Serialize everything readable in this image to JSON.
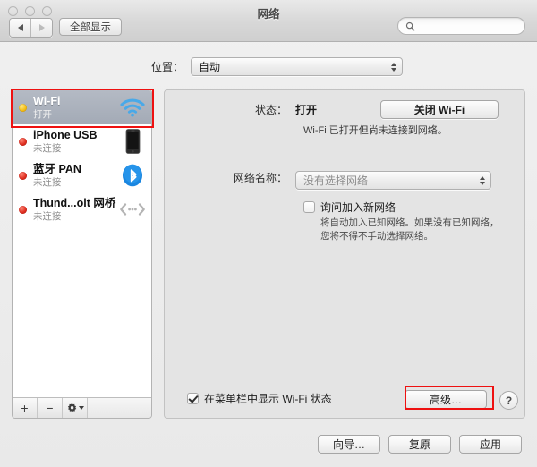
{
  "window": {
    "title": "网络",
    "traffic_lights": [
      "close",
      "minimize",
      "zoom"
    ]
  },
  "toolbar": {
    "back_icon": "triangle-left-icon",
    "forward_icon": "triangle-right-icon",
    "show_all_label": "全部显示",
    "search_placeholder": "",
    "search_value": "",
    "search_icon": "search-icon"
  },
  "location": {
    "label": "位置：",
    "selected": "自动"
  },
  "sidebar": {
    "services": [
      {
        "name": "Wi-Fi",
        "state": "打开",
        "status": "on",
        "dot_color": "#f5c018",
        "icon": "wifi-icon",
        "selected": true
      },
      {
        "name": "iPhone USB",
        "state": "未连接",
        "status": "off",
        "dot_color": "#e03022",
        "icon": "iphone-icon",
        "selected": false
      },
      {
        "name": "蓝牙 PAN",
        "state": "未连接",
        "status": "off",
        "dot_color": "#e03022",
        "icon": "bluetooth-icon",
        "selected": false
      },
      {
        "name": "Thund...olt 网桥",
        "state": "未连接",
        "status": "off",
        "dot_color": "#e03022",
        "icon": "thunderbolt-bridge-icon",
        "selected": false
      }
    ],
    "footer": {
      "add_label": "+",
      "remove_label": "−",
      "action_icon": "gear-icon"
    }
  },
  "detail": {
    "status_label": "状态：",
    "status_value": "打开",
    "status_description": "Wi-Fi 已打开但尚未连接到网络。",
    "toggle_button": "关闭 Wi-Fi",
    "network_name_label": "网络名称：",
    "network_name_value": "没有选择网络",
    "ask_join_label": "询问加入新网络",
    "ask_join_checked": false,
    "ask_join_description": "将自动加入已知网络。如果没有已知网络，您将不得不手动选择网络。",
    "menubar_label": "在菜单栏中显示 Wi-Fi 状态",
    "menubar_checked": true,
    "advanced_button": "高级…",
    "help_button": "?"
  },
  "bottom": {
    "assist_label": "向导…",
    "revert_label": "复原",
    "apply_label": "应用"
  },
  "annotations": {
    "color": "#ee1111",
    "targets": [
      "wifi-service-row",
      "advanced-button"
    ]
  }
}
